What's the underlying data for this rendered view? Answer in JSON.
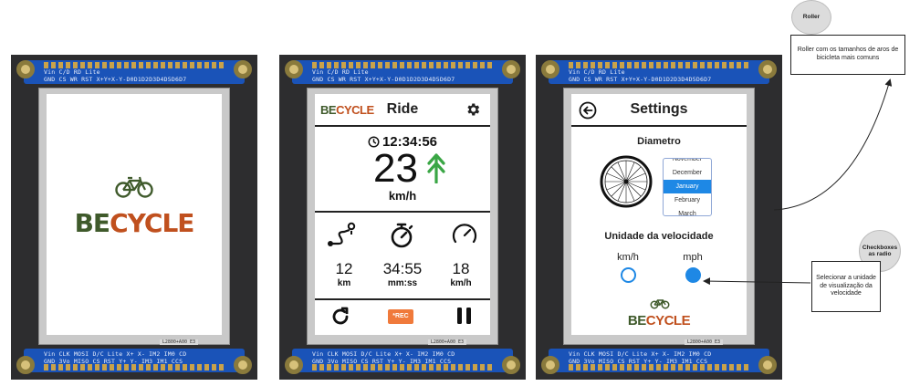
{
  "boards": {
    "top_pins_row1": "Vin C/D RD Lite",
    "top_pins_row2": "GND CS WR RST X+Y+X-Y-D0D1D2D3D4D5D6D7",
    "bottom_pins_row1": "Vin CLK MOSI D/C Lite X+ X- IM2 IM0 CD",
    "bottom_pins_row2": "GND 3Vo MISO CS RST Y+ Y- IM3 IM1 CCS",
    "flex_label": "L2800+A00 E3"
  },
  "splash": {
    "brand_be": "BE",
    "brand_cycle": "CYCLE",
    "icon": "bicycle-icon"
  },
  "ride": {
    "brand_be": "BE",
    "brand_cycle": "CYCLE",
    "title": "Ride",
    "settings_icon": "gear-icon",
    "clock": "12:34:56",
    "speed": "23",
    "speed_unit": "km/h",
    "trend_icon": "double-arrow-up-icon",
    "stats": [
      {
        "icon": "route-icon",
        "value": "12",
        "unit": "km"
      },
      {
        "icon": "stopwatch-icon",
        "value": "34:55",
        "unit": "mm:ss"
      },
      {
        "icon": "speedometer-icon",
        "value": "18",
        "unit": "km/h"
      }
    ],
    "rec_label": "*REC",
    "reset_icon": "reset-icon",
    "pause_icon": "pause-icon"
  },
  "settings": {
    "title": "Settings",
    "back_icon": "back-arrow-icon",
    "diameter_label": "Diametro",
    "roller_items": [
      "November",
      "December",
      "January",
      "February",
      "March"
    ],
    "roller_selected": "January",
    "unit_label": "Unidade da velocidade",
    "options": [
      "km/h",
      "mph"
    ],
    "selected_option": "mph",
    "brand_be": "BE",
    "brand_cycle": "CYCLE"
  },
  "annotations": {
    "roller_title": "Roller",
    "roller_note": "Roller com os tamanhos de aros de bicicleta mais comuns",
    "checkbox_title": "Checkboxes as radio",
    "checkbox_note": "Selecionar a unidade de visualização da velocidade"
  },
  "colors": {
    "brand_green": "#3f5a2b",
    "brand_orange": "#c0501e",
    "accent_blue": "#1e88e5",
    "trend_green": "#3aa645",
    "rec_orange": "#f07a3b",
    "pcb_blue": "#1a53b8"
  }
}
